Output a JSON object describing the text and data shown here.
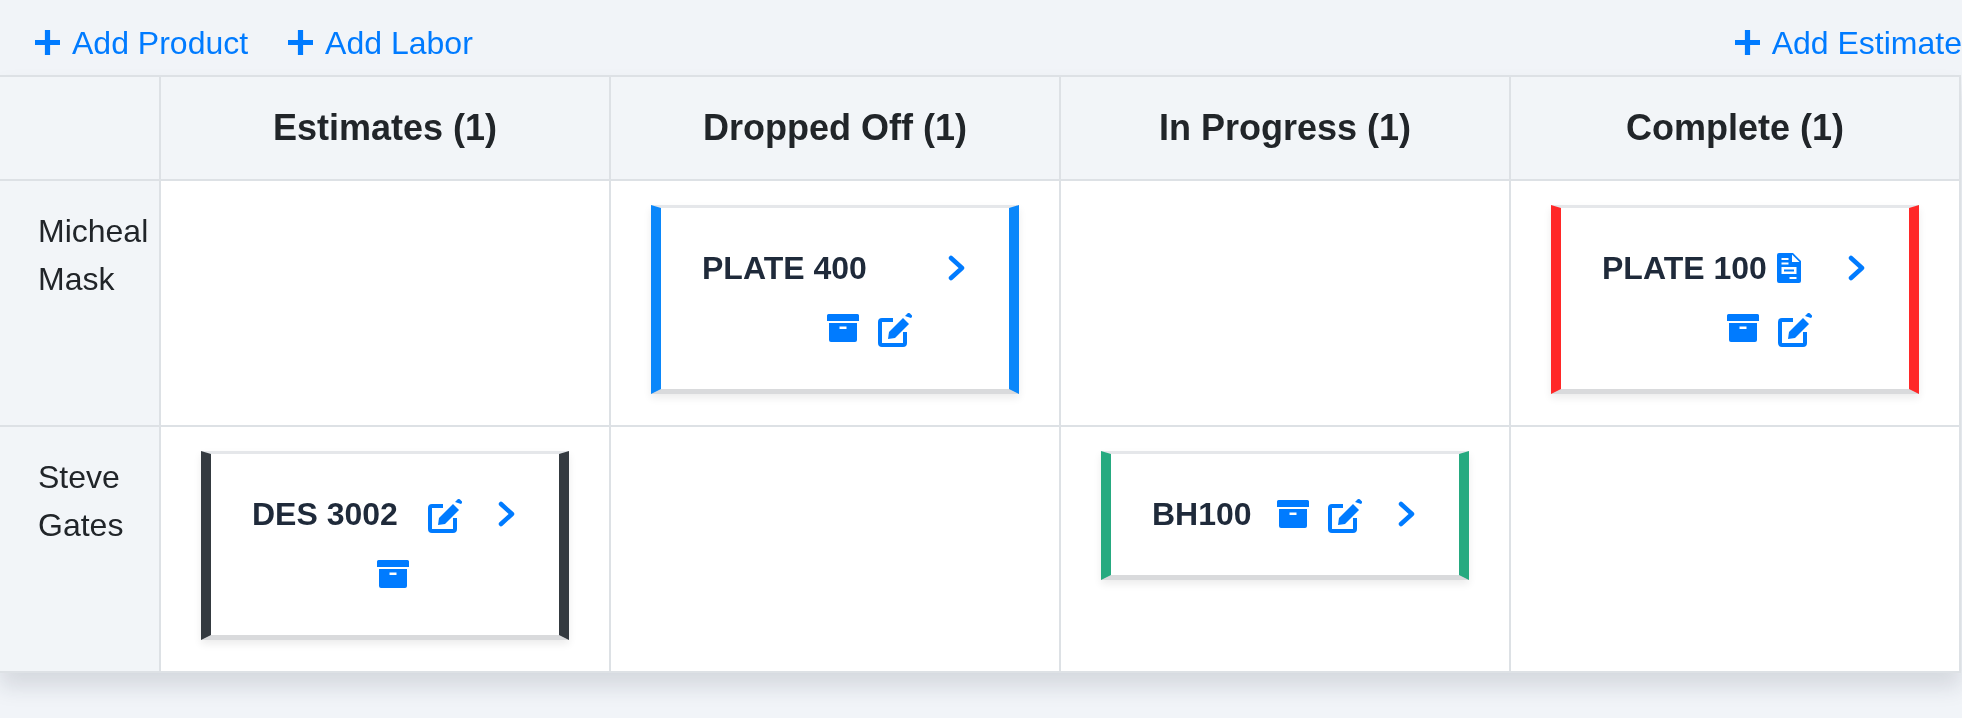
{
  "toolbar": {
    "left_links": [
      {
        "label": "Add Product"
      },
      {
        "label": "Add Labor"
      }
    ],
    "right_links": [
      {
        "label": "Add Estimate"
      }
    ]
  },
  "board": {
    "columns": [
      {
        "label": "Estimates (1)"
      },
      {
        "label": "Dropped Off (1)"
      },
      {
        "label": "In Progress (1)"
      },
      {
        "label": "Complete (1)"
      }
    ],
    "rows": [
      {
        "name": "Micheal Mask",
        "cells": [
          null,
          {
            "color": "#0a87fa",
            "lines": [
              [
                {
                  "kind": "title",
                  "text": "PLATE 400"
                }
              ],
              [
                {
                  "kind": "archive"
                },
                {
                  "kind": "edit"
                }
              ]
            ]
          },
          null,
          {
            "color": "#ff2828",
            "lines": [
              [
                {
                  "kind": "title",
                  "text": "PLATE 100"
                },
                {
                  "kind": "document"
                }
              ],
              [
                {
                  "kind": "archive"
                },
                {
                  "kind": "edit"
                }
              ]
            ]
          }
        ]
      },
      {
        "name": "Steve Gates",
        "cells": [
          {
            "color": "#343a40",
            "lines": [
              [
                {
                  "kind": "title",
                  "text": "DES 3002"
                },
                {
                  "kind": "edit"
                }
              ],
              [
                {
                  "kind": "archive"
                }
              ]
            ]
          },
          null,
          {
            "color": "#26aa80",
            "lines": [
              [
                {
                  "kind": "title",
                  "text": "BH100"
                },
                {
                  "kind": "archive"
                },
                {
                  "kind": "edit"
                }
              ]
            ]
          },
          null
        ]
      }
    ]
  }
}
